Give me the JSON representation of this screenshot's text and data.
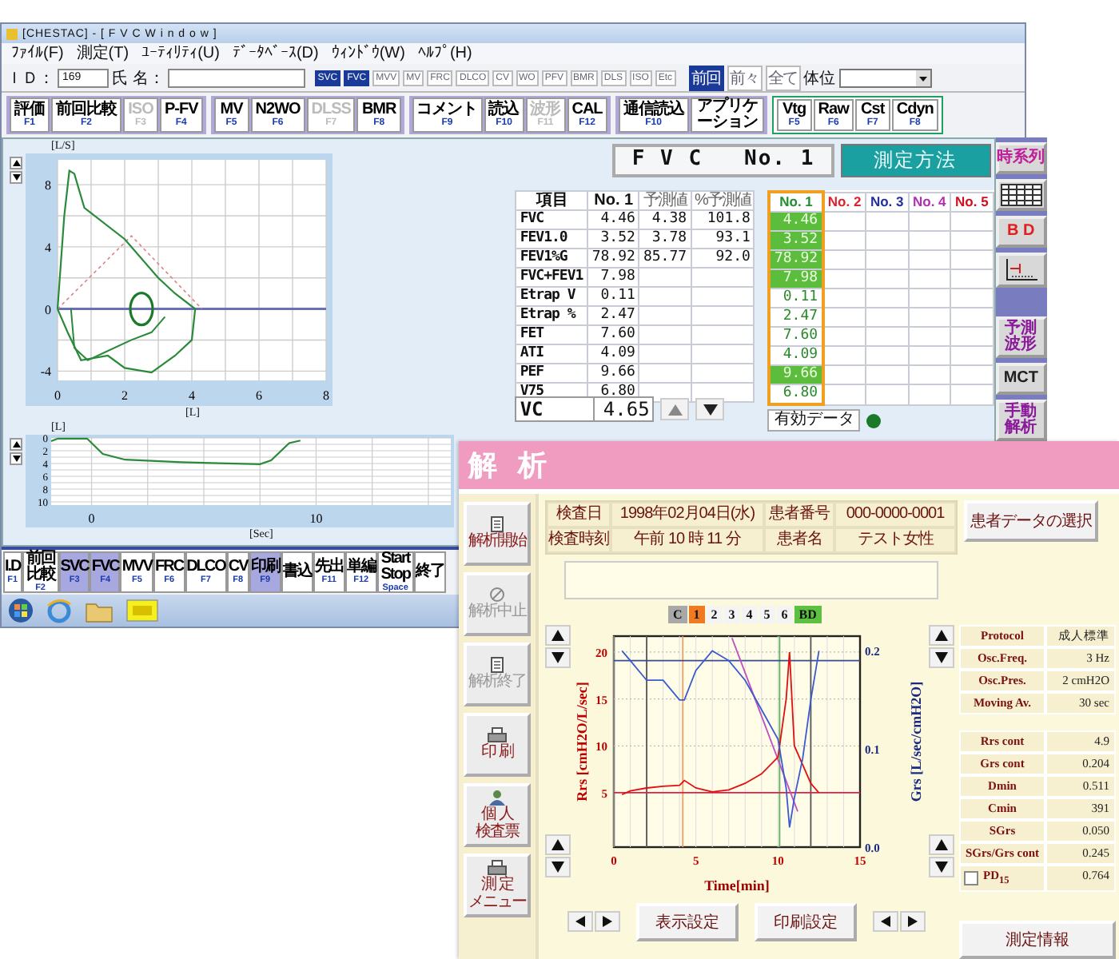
{
  "window": {
    "title": "[CHESTAC] - [ F V C   W i n d o w ]"
  },
  "menu": [
    "ﾌｧｲﾙ(F)",
    "測定(T)",
    "ﾕｰﾃｨﾘﾃｨ(U)",
    "ﾃﾞｰﾀﾍﾞｰｽ(D)",
    "ｳｨﾝﾄﾞｳ(W)",
    "ﾍﾙﾌﾟ(H)"
  ],
  "patient_bar": {
    "id_label": "ＩＤ：",
    "id_value": "169",
    "name_label": "氏 名：",
    "test_toggles": [
      {
        "label": "SVC",
        "selected": true
      },
      {
        "label": "FVC",
        "selected": true
      },
      {
        "label": "MVV",
        "selected": false
      },
      {
        "label": "MV",
        "selected": false
      },
      {
        "label": "FRC",
        "selected": false
      },
      {
        "label": "DLCO",
        "selected": false
      },
      {
        "label": "CV",
        "selected": false
      },
      {
        "label": "WO",
        "selected": false
      },
      {
        "label": "PFV",
        "selected": false
      },
      {
        "label": "BMR",
        "selected": false
      },
      {
        "label": "DLS",
        "selected": false
      },
      {
        "label": "ISO",
        "selected": false
      },
      {
        "label": "Etc",
        "selected": false
      }
    ],
    "view_toggles": [
      {
        "label": "前回",
        "selected": true
      },
      {
        "label": "前々",
        "selected": false
      },
      {
        "label": "全て",
        "selected": false
      }
    ],
    "posture_label": "体位"
  },
  "function_keys": [
    {
      "outlined": false,
      "buttons": [
        {
          "label": "評価",
          "key": "F1",
          "disabled": false
        },
        {
          "label": "前回比較",
          "key": "F2",
          "disabled": false
        },
        {
          "label": "ISO",
          "key": "F3",
          "disabled": true
        },
        {
          "label": "P-FV",
          "key": "F4",
          "disabled": false
        }
      ]
    },
    {
      "outlined": false,
      "buttons": [
        {
          "label": "MV",
          "key": "F5",
          "disabled": false
        },
        {
          "label": "N2WO",
          "key": "F6",
          "disabled": false
        },
        {
          "label": "DLSS",
          "key": "F7",
          "disabled": true
        },
        {
          "label": "BMR",
          "key": "F8",
          "disabled": false
        }
      ]
    },
    {
      "outlined": false,
      "buttons": [
        {
          "label": "コメント",
          "key": "F9",
          "disabled": false
        },
        {
          "label": "読込",
          "key": "F10",
          "disabled": false
        },
        {
          "label": "波形",
          "key": "F11",
          "disabled": true
        },
        {
          "label": "CAL",
          "key": "F12",
          "disabled": false
        }
      ]
    },
    {
      "outlined": false,
      "buttons": [
        {
          "label": "通信読込",
          "key": "F10",
          "disabled": false
        },
        {
          "label": "アプリケーション",
          "disabled": false
        }
      ]
    },
    {
      "outlined": true,
      "buttons": [
        {
          "label": "Vtg",
          "key": "F5",
          "disabled": false
        },
        {
          "label": "Raw",
          "key": "F6",
          "disabled": false
        },
        {
          "label": "Cst",
          "key": "F7",
          "disabled": false
        },
        {
          "label": "Cdyn",
          "key": "F8",
          "disabled": false
        }
      ]
    }
  ],
  "flow_volume": {
    "y_unit": "[L/S]",
    "x_unit": "[L]",
    "y_ticks": [
      "8",
      "4",
      "0",
      "-4"
    ],
    "x_ticks": [
      "0",
      "2",
      "4",
      "6",
      "8"
    ]
  },
  "volume_time": {
    "y_unit": "[L]",
    "x_unit": "[Sec]",
    "y_ticks": [
      "0",
      "2",
      "4",
      "6",
      "8",
      "10"
    ],
    "x_ticks": [
      "0",
      "10"
    ]
  },
  "fvc_header": {
    "title": "F V C",
    "trial": "No. 1",
    "method_button": "測定方法"
  },
  "results_table": {
    "columns": [
      "項目",
      "No. 1",
      "予測値",
      "%予測値"
    ],
    "rows": [
      {
        "item": "FVC",
        "no1": "4.46",
        "predicted": "4.38",
        "percent": "101.8"
      },
      {
        "item": "FEV1.0",
        "no1": "3.52",
        "predicted": "3.78",
        "percent": "93.1"
      },
      {
        "item": "FEV1%G",
        "no1": "78.92",
        "predicted": "85.77",
        "percent": "92.0"
      },
      {
        "item": "FVC+FEV1",
        "no1": "7.98"
      },
      {
        "item": "Etrap V",
        "no1": "0.11"
      },
      {
        "item": "Etrap %",
        "no1": "2.47"
      },
      {
        "item": "FET",
        "no1": "7.60"
      },
      {
        "item": "ATI",
        "no1": "4.09"
      },
      {
        "item": "PEF",
        "no1": "9.66"
      },
      {
        "item": "V75",
        "no1": "6.80"
      }
    ]
  },
  "trials": {
    "columns": [
      {
        "label": "No. 1",
        "color": "#1f8f2f",
        "selected": true
      },
      {
        "label": "No. 2",
        "color": "#e0202a",
        "selected": false
      },
      {
        "label": "No. 3",
        "color": "#2030a0",
        "selected": false
      },
      {
        "label": "No. 4",
        "color": "#b030b0",
        "selected": false
      },
      {
        "label": "No. 5",
        "color": "#d01020",
        "selected": false
      }
    ],
    "values": [
      {
        "value": "4.46",
        "highlighted": true
      },
      {
        "value": "3.52",
        "highlighted": true
      },
      {
        "value": "78.92",
        "highlighted": true
      },
      {
        "value": "7.98",
        "highlighted": true
      },
      {
        "value": "0.11",
        "highlighted": false
      },
      {
        "value": "2.47",
        "highlighted": false
      },
      {
        "value": "7.60",
        "highlighted": false
      },
      {
        "value": "4.09",
        "highlighted": false
      },
      {
        "value": "9.66",
        "highlighted": true
      },
      {
        "value": "6.80",
        "highlighted": false
      }
    ],
    "valid_label": "有効データ",
    "valid_marked": true
  },
  "vc": {
    "label": "VC",
    "value": "4.65"
  },
  "side_buttons": [
    {
      "kind": "text",
      "lines": [
        "時系列"
      ],
      "color": "#c0209a"
    },
    {
      "kind": "grid"
    },
    {
      "kind": "text",
      "lines": [
        "B D"
      ],
      "color": "#e02020"
    },
    {
      "kind": "graph"
    },
    {
      "kind": "spacer"
    },
    {
      "kind": "text",
      "lines": [
        "予測",
        "波形"
      ],
      "color": "#8a1a9a"
    },
    {
      "kind": "text",
      "lines": [
        "MCT"
      ],
      "color": "#202020"
    },
    {
      "kind": "text",
      "lines": [
        "手動",
        "解析"
      ],
      "color": "#8a1a9a"
    }
  ],
  "bottom_keys": [
    {
      "label": "I.D",
      "key": "F1",
      "selected": false
    },
    {
      "label": "前回比較",
      "key": "F2",
      "selected": false
    },
    {
      "label": "SVC",
      "key": "F3",
      "selected": true
    },
    {
      "label": "FVC",
      "key": "F4",
      "selected": true
    },
    {
      "label": "MVV",
      "key": "F5",
      "selected": false
    },
    {
      "label": "FRC",
      "key": "F6",
      "selected": false
    },
    {
      "label": "DLCO",
      "key": "F7",
      "selected": false
    },
    {
      "label": "CV",
      "key": "F8",
      "selected": false
    },
    {
      "label": "印刷",
      "key": "F9",
      "selected": true
    },
    {
      "label": "書込",
      "selected": false
    },
    {
      "label": "先出",
      "key": "F11",
      "selected": false
    },
    {
      "label": "単編",
      "key": "F12",
      "selected": false
    },
    {
      "label": "Start Stop",
      "key": "Space",
      "selected": false
    },
    {
      "label": "終了",
      "selected": false
    }
  ],
  "analysis": {
    "title": "解 析",
    "side_buttons": [
      {
        "lines": [
          "解析開始"
        ],
        "kind": "document",
        "disabled": false
      },
      {
        "lines": [
          "解析中止"
        ],
        "kind": "stop",
        "disabled": true
      },
      {
        "lines": [
          "解析終了"
        ],
        "kind": "document",
        "disabled": true
      },
      {
        "lines": [
          "印 刷"
        ],
        "kind": "printer",
        "disabled": false
      },
      {
        "lines": [
          "個 人",
          "検査票"
        ],
        "kind": "person",
        "disabled": false
      },
      {
        "lines": [
          "測 定",
          "メニュー"
        ],
        "kind": "printer",
        "disabled": false
      }
    ],
    "info": [
      {
        "label": "検査日",
        "value": "1998年02月04日(水)"
      },
      {
        "label": "患者番号",
        "value": "000-0000-0001"
      },
      {
        "label": "検査時刻",
        "value": "午前 10 時 11 分"
      },
      {
        "label": "患者名",
        "value": "テスト女性"
      }
    ],
    "select_button": "患者データの選択",
    "chart_tabs": [
      {
        "label": "C",
        "color": "#a8a8a8"
      },
      {
        "label": "1",
        "color": "#f07a20"
      },
      {
        "label": "2",
        "color": "#f4f4f4"
      },
      {
        "label": "3",
        "color": "#f4f4f4"
      },
      {
        "label": "4",
        "color": "#f4f4f4"
      },
      {
        "label": "5",
        "color": "#f4f4f4"
      },
      {
        "label": "6",
        "color": "#f4f4f4"
      },
      {
        "label": "BD",
        "color": "#5cc040"
      }
    ],
    "chart": {
      "chart_data": {
        "type": "line",
        "xlabel": "Time[min]",
        "ylabel": "Rrs [cmH2O/L/sec]",
        "y2label": "Grs [L/sec/cmH2O]",
        "grid": true,
        "x": [
          0.5,
          1,
          2,
          3,
          4,
          4.3,
          5,
          6,
          7,
          8,
          9,
          10,
          10.5,
          10.7,
          11,
          11.5,
          12,
          12.5
        ],
        "series": [
          {
            "color": "#e01010",
            "values": [
              4.8,
              5.2,
              5.5,
              5.7,
              5.8,
              6.3,
              5.5,
              5.1,
              5.3,
              6,
              7,
              8.8,
              15,
              20,
              10,
              8,
              6,
              5
            ]
          },
          {
            "color": "#3a5ad0",
            "axis": "y2",
            "values": [
              0.2,
              0.19,
              0.17,
              0.17,
              0.15,
              0.15,
              0.18,
              0.2,
              0.19,
              0.17,
              0.14,
              0.11,
              0.06,
              0.02,
              0.05,
              0.09,
              0.15,
              0.2
            ]
          }
        ],
        "xlim": [
          0,
          15
        ],
        "ylim": [
          -0.8,
          21.7
        ],
        "y2lim": [
          0,
          0.215
        ],
        "xticks": [
          0,
          5,
          10,
          15
        ],
        "yticks": [
          5,
          10,
          15,
          20
        ],
        "y2ticks": [
          {
            "value": 0.2,
            "label": "0.2"
          },
          {
            "value": 0.1,
            "label": "0.1"
          },
          {
            "value": 0,
            "label": "0.0"
          }
        ],
        "ref_lines": [
          {
            "axis": "x",
            "value": 2,
            "color": "#555555"
          },
          {
            "axis": "x",
            "value": 4.2,
            "color": "#f0a060"
          },
          {
            "axis": "x",
            "value": 10.1,
            "color": "#60b060"
          },
          {
            "axis": "x",
            "value": 12,
            "color": "#555555"
          },
          {
            "axis": "y",
            "value": 5,
            "color": "#e02040"
          },
          {
            "axis": "y2",
            "value": 0.19,
            "color": "#3a4a90"
          }
        ]
      }
    },
    "buttons": [
      "表示設定",
      "印刷設定"
    ],
    "settings": [
      {
        "label": "Protocol",
        "value": "成人標準"
      },
      {
        "label": "Osc.Freq.",
        "value": "3 Hz"
      },
      {
        "label": "Osc.Pres.",
        "value": "2 cmH2O"
      },
      {
        "label": "Moving Av.",
        "value": "30 sec"
      }
    ],
    "results": [
      {
        "label": "Rrs cont",
        "value": "4.9"
      },
      {
        "label": "Grs cont",
        "value": "0.204"
      },
      {
        "label": "Dmin",
        "value": "0.511"
      },
      {
        "label": "Cmin",
        "value": "391"
      },
      {
        "label": "SGrs",
        "value": "0.050"
      },
      {
        "label": "SGrs/Grs cont",
        "value": "0.245"
      },
      {
        "label": "PD$_{15}$",
        "value": "0.764",
        "kind": "checkbox",
        "checked": false
      }
    ],
    "info_button": "測定情報"
  }
}
